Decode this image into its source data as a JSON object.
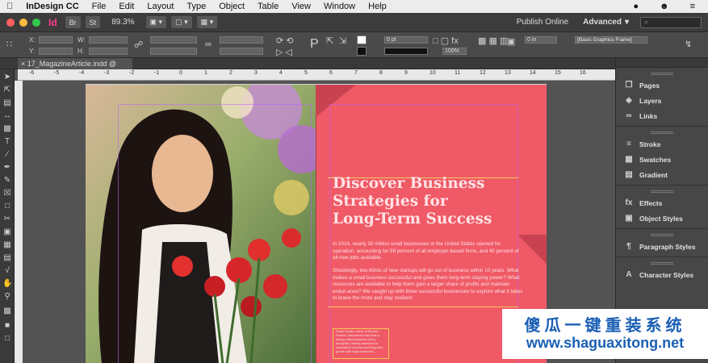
{
  "menubar": {
    "apple": "",
    "app": "InDesign CC",
    "items": [
      "File",
      "Edit",
      "Layout",
      "Type",
      "Object",
      "Table",
      "View",
      "Window",
      "Help"
    ]
  },
  "appbar": {
    "logo": "Id",
    "badges": [
      "Br",
      "St"
    ],
    "zoom": "89.3%",
    "publish": "Publish Online",
    "workspace": "Advanced",
    "workspace_arrow": "▾",
    "search_icon": "⌕"
  },
  "control": {
    "x_label": "X:",
    "y_label": "Y:",
    "w_label": "W:",
    "h_label": "H:",
    "stroke_weight": "0 pt",
    "opacity": "100%",
    "gap": "0 in",
    "frame_style": "[Basic Graphics Frame]"
  },
  "document": {
    "tab": "17_MagazineArticle.indd @ 89%",
    "ruler_labels": [
      "-6",
      "-5",
      "-4",
      "-3",
      "-2",
      "-1",
      "0",
      "1",
      "2",
      "3",
      "4",
      "5",
      "6",
      "7",
      "8",
      "9",
      "10",
      "11",
      "12",
      "13",
      "14",
      "15",
      "16"
    ]
  },
  "article": {
    "headline": [
      "Discover Business",
      "Strategies for",
      "Long-Term Success"
    ],
    "para1": "In 2014, nearly 30 million small businesses in the United States opened for operation, accounting for 99 percent of all employer-based firms, and 40 percent of all new jobs available.",
    "para2": "Shockingly, two-thirds of new startups will go out of business within 10 years. What makes a small business successful and gives them long-term staying power? What resources are available to help them gain a larger share of profits and maintain endur-ance? We caught up with three successful businesses to explore what it takes to brave the more and stay resilient.",
    "quote": "Susan Davila, owner of Blooms Flowers, discovered early that a strong online presence and a thoughtful, friendly storefront is essential to success and long-term growth with loyal customers."
  },
  "panels": {
    "groups": [
      [
        {
          "icon": "pages-icon",
          "glyph": "❐",
          "label": "Pages"
        },
        {
          "icon": "layers-icon",
          "glyph": "◈",
          "label": "Layers"
        },
        {
          "icon": "links-icon",
          "glyph": "∞",
          "label": "Links"
        }
      ],
      [
        {
          "icon": "stroke-icon",
          "glyph": "≡",
          "label": "Stroke"
        },
        {
          "icon": "swatches-icon",
          "glyph": "▦",
          "label": "Swatches"
        },
        {
          "icon": "gradient-icon",
          "glyph": "▤",
          "label": "Gradient"
        }
      ],
      [
        {
          "icon": "effects-icon",
          "glyph": "fx",
          "label": "Effects"
        },
        {
          "icon": "object-styles-icon",
          "glyph": "▣",
          "label": "Object Styles"
        }
      ],
      [
        {
          "icon": "paragraph-styles-icon",
          "glyph": "¶",
          "label": "Paragraph Styles"
        }
      ],
      [
        {
          "icon": "character-styles-icon",
          "glyph": "A",
          "label": "Character Styles"
        }
      ]
    ]
  },
  "watermark": {
    "title": "傻瓜一键重装系统",
    "url": "www.shaguaxitong.net"
  },
  "colors": {
    "page_bg": "#ef5a66",
    "headline": "#ffe2e5",
    "indesign_pink": "#ff3d8b",
    "watermark": "#1a5fb4"
  }
}
